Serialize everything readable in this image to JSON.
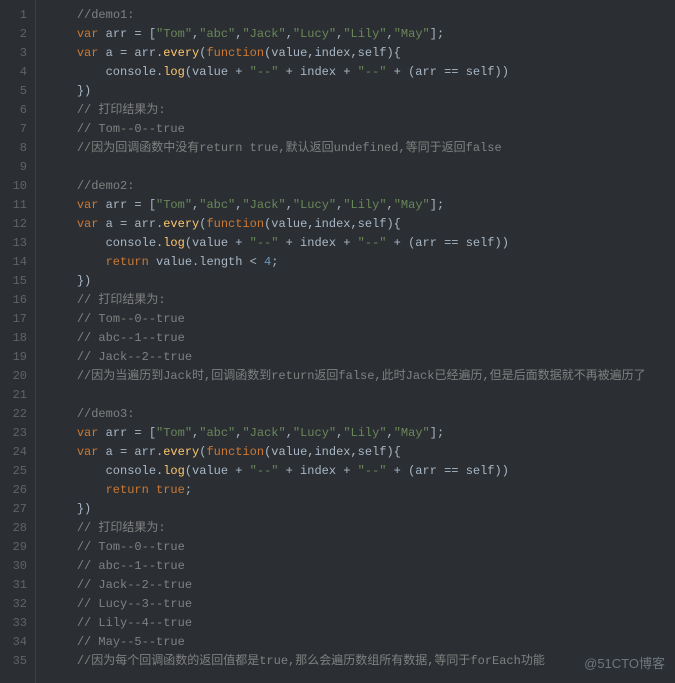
{
  "watermark": "@51CTO博客",
  "lineNumbers": [
    1,
    2,
    3,
    4,
    5,
    6,
    7,
    8,
    9,
    10,
    11,
    12,
    13,
    14,
    15,
    16,
    17,
    18,
    19,
    20,
    21,
    22,
    23,
    24,
    25,
    26,
    27,
    28,
    29,
    30,
    31,
    32,
    33,
    34,
    35
  ],
  "code": [
    {
      "i": "    ",
      "t": [
        {
          "c": "cm",
          "v": "//demo1:"
        }
      ]
    },
    {
      "i": "    ",
      "t": [
        {
          "c": "kw",
          "v": "var"
        },
        {
          "c": "p",
          "v": " arr = ["
        },
        {
          "c": "str",
          "v": "\"Tom\""
        },
        {
          "c": "p",
          "v": ","
        },
        {
          "c": "str",
          "v": "\"abc\""
        },
        {
          "c": "p",
          "v": ","
        },
        {
          "c": "str",
          "v": "\"Jack\""
        },
        {
          "c": "p",
          "v": ","
        },
        {
          "c": "str",
          "v": "\"Lucy\""
        },
        {
          "c": "p",
          "v": ","
        },
        {
          "c": "str",
          "v": "\"Lily\""
        },
        {
          "c": "p",
          "v": ","
        },
        {
          "c": "str",
          "v": "\"May\""
        },
        {
          "c": "p",
          "v": "];"
        }
      ]
    },
    {
      "i": "    ",
      "t": [
        {
          "c": "kw",
          "v": "var"
        },
        {
          "c": "p",
          "v": " a = arr."
        },
        {
          "c": "fn",
          "v": "every"
        },
        {
          "c": "p",
          "v": "("
        },
        {
          "c": "kw",
          "v": "function"
        },
        {
          "c": "p",
          "v": "(value,index,self){"
        }
      ]
    },
    {
      "i": "        ",
      "t": [
        {
          "c": "p",
          "v": "console."
        },
        {
          "c": "fn",
          "v": "log"
        },
        {
          "c": "p",
          "v": "(value + "
        },
        {
          "c": "str",
          "v": "\"--\""
        },
        {
          "c": "p",
          "v": " + index + "
        },
        {
          "c": "str",
          "v": "\"--\""
        },
        {
          "c": "p",
          "v": " + (arr == self))"
        }
      ]
    },
    {
      "i": "    ",
      "t": [
        {
          "c": "p",
          "v": "})"
        }
      ]
    },
    {
      "i": "    ",
      "t": [
        {
          "c": "cm",
          "v": "// 打印结果为:"
        }
      ]
    },
    {
      "i": "    ",
      "t": [
        {
          "c": "cm",
          "v": "// Tom--0--true"
        }
      ]
    },
    {
      "i": "    ",
      "t": [
        {
          "c": "cm",
          "v": "//因为回调函数中没有return true,默认返回undefined,等同于返回false"
        }
      ]
    },
    {
      "i": "",
      "t": []
    },
    {
      "i": "    ",
      "t": [
        {
          "c": "cm",
          "v": "//demo2:"
        }
      ]
    },
    {
      "i": "    ",
      "t": [
        {
          "c": "kw",
          "v": "var"
        },
        {
          "c": "p",
          "v": " arr = ["
        },
        {
          "c": "str",
          "v": "\"Tom\""
        },
        {
          "c": "p",
          "v": ","
        },
        {
          "c": "str",
          "v": "\"abc\""
        },
        {
          "c": "p",
          "v": ","
        },
        {
          "c": "str",
          "v": "\"Jack\""
        },
        {
          "c": "p",
          "v": ","
        },
        {
          "c": "str",
          "v": "\"Lucy\""
        },
        {
          "c": "p",
          "v": ","
        },
        {
          "c": "str",
          "v": "\"Lily\""
        },
        {
          "c": "p",
          "v": ","
        },
        {
          "c": "str",
          "v": "\"May\""
        },
        {
          "c": "p",
          "v": "];"
        }
      ]
    },
    {
      "i": "    ",
      "t": [
        {
          "c": "kw",
          "v": "var"
        },
        {
          "c": "p",
          "v": " a = arr."
        },
        {
          "c": "fn",
          "v": "every"
        },
        {
          "c": "p",
          "v": "("
        },
        {
          "c": "kw",
          "v": "function"
        },
        {
          "c": "p",
          "v": "(value,index,self){"
        }
      ]
    },
    {
      "i": "        ",
      "t": [
        {
          "c": "p",
          "v": "console."
        },
        {
          "c": "fn",
          "v": "log"
        },
        {
          "c": "p",
          "v": "(value + "
        },
        {
          "c": "str",
          "v": "\"--\""
        },
        {
          "c": "p",
          "v": " + index + "
        },
        {
          "c": "str",
          "v": "\"--\""
        },
        {
          "c": "p",
          "v": " + (arr == self))"
        }
      ]
    },
    {
      "i": "        ",
      "t": [
        {
          "c": "kw",
          "v": "return"
        },
        {
          "c": "p",
          "v": " value.length < "
        },
        {
          "c": "num",
          "v": "4"
        },
        {
          "c": "p",
          "v": ";"
        }
      ]
    },
    {
      "i": "    ",
      "t": [
        {
          "c": "p",
          "v": "})"
        }
      ]
    },
    {
      "i": "    ",
      "t": [
        {
          "c": "cm",
          "v": "// 打印结果为:"
        }
      ]
    },
    {
      "i": "    ",
      "t": [
        {
          "c": "cm",
          "v": "// Tom--0--true"
        }
      ]
    },
    {
      "i": "    ",
      "t": [
        {
          "c": "cm",
          "v": "// abc--1--true"
        }
      ]
    },
    {
      "i": "    ",
      "t": [
        {
          "c": "cm",
          "v": "// Jack--2--true"
        }
      ]
    },
    {
      "i": "    ",
      "t": [
        {
          "c": "cm",
          "v": "//因为当遍历到Jack时,回调函数到return返回false,此时Jack已经遍历,但是后面数据就不再被遍历了"
        }
      ]
    },
    {
      "i": "",
      "t": []
    },
    {
      "i": "    ",
      "t": [
        {
          "c": "cm",
          "v": "//demo3:"
        }
      ]
    },
    {
      "i": "    ",
      "t": [
        {
          "c": "kw",
          "v": "var"
        },
        {
          "c": "p",
          "v": " arr = ["
        },
        {
          "c": "str",
          "v": "\"Tom\""
        },
        {
          "c": "p",
          "v": ","
        },
        {
          "c": "str",
          "v": "\"abc\""
        },
        {
          "c": "p",
          "v": ","
        },
        {
          "c": "str",
          "v": "\"Jack\""
        },
        {
          "c": "p",
          "v": ","
        },
        {
          "c": "str",
          "v": "\"Lucy\""
        },
        {
          "c": "p",
          "v": ","
        },
        {
          "c": "str",
          "v": "\"Lily\""
        },
        {
          "c": "p",
          "v": ","
        },
        {
          "c": "str",
          "v": "\"May\""
        },
        {
          "c": "p",
          "v": "];"
        }
      ]
    },
    {
      "i": "    ",
      "t": [
        {
          "c": "kw",
          "v": "var"
        },
        {
          "c": "p",
          "v": " a = arr."
        },
        {
          "c": "fn",
          "v": "every"
        },
        {
          "c": "p",
          "v": "("
        },
        {
          "c": "kw",
          "v": "function"
        },
        {
          "c": "p",
          "v": "(value,index,self){"
        }
      ]
    },
    {
      "i": "        ",
      "t": [
        {
          "c": "p",
          "v": "console."
        },
        {
          "c": "fn",
          "v": "log"
        },
        {
          "c": "p",
          "v": "(value + "
        },
        {
          "c": "str",
          "v": "\"--\""
        },
        {
          "c": "p",
          "v": " + index + "
        },
        {
          "c": "str",
          "v": "\"--\""
        },
        {
          "c": "p",
          "v": " + (arr == self))"
        }
      ]
    },
    {
      "i": "        ",
      "t": [
        {
          "c": "kw",
          "v": "return"
        },
        {
          "c": "p",
          "v": " "
        },
        {
          "c": "kw",
          "v": "true"
        },
        {
          "c": "p",
          "v": ";"
        }
      ]
    },
    {
      "i": "    ",
      "t": [
        {
          "c": "p",
          "v": "})"
        }
      ]
    },
    {
      "i": "    ",
      "t": [
        {
          "c": "cm",
          "v": "// 打印结果为:"
        }
      ]
    },
    {
      "i": "    ",
      "t": [
        {
          "c": "cm",
          "v": "// Tom--0--true"
        }
      ]
    },
    {
      "i": "    ",
      "t": [
        {
          "c": "cm",
          "v": "// abc--1--true"
        }
      ]
    },
    {
      "i": "    ",
      "t": [
        {
          "c": "cm",
          "v": "// Jack--2--true"
        }
      ]
    },
    {
      "i": "    ",
      "t": [
        {
          "c": "cm",
          "v": "// Lucy--3--true"
        }
      ]
    },
    {
      "i": "    ",
      "t": [
        {
          "c": "cm",
          "v": "// Lily--4--true"
        }
      ]
    },
    {
      "i": "    ",
      "t": [
        {
          "c": "cm",
          "v": "// May--5--true"
        }
      ]
    },
    {
      "i": "    ",
      "t": [
        {
          "c": "cm",
          "v": "//因为每个回调函数的返回值都是true,那么会遍历数组所有数据,等同于forEach功能"
        }
      ]
    }
  ]
}
